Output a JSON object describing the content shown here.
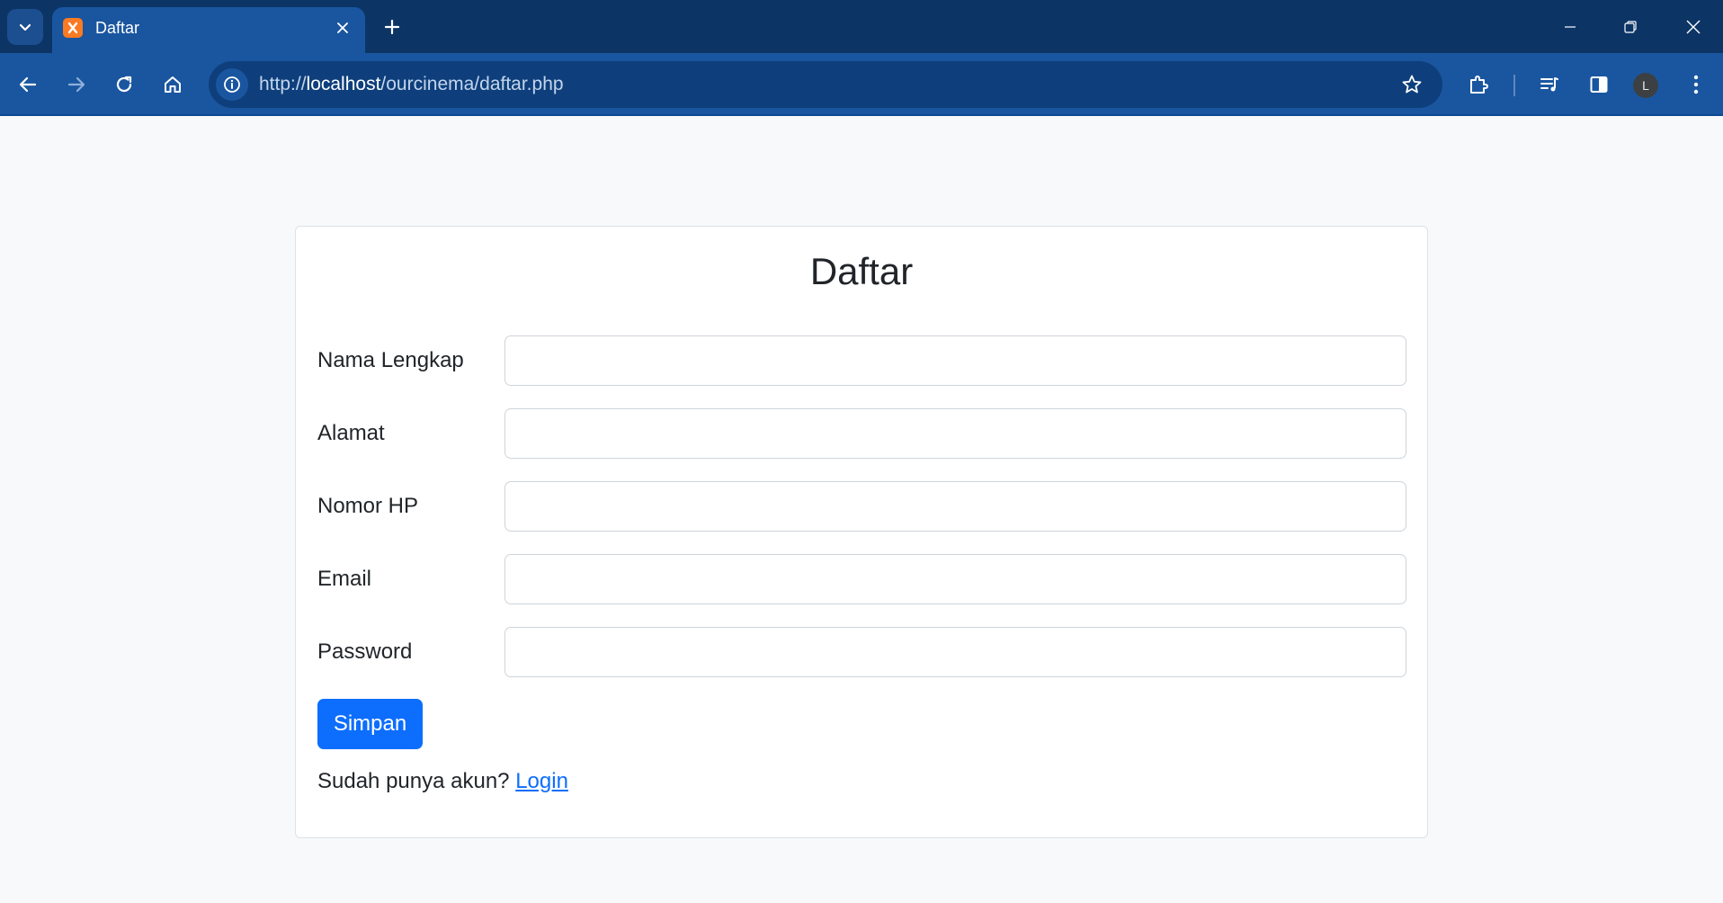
{
  "browser": {
    "tab_title": "Daftar",
    "url_scheme": "http://",
    "url_host": "localhost",
    "url_path": "/ourcinema/daftar.php",
    "profile_initial": "L",
    "colors": {
      "tabstrip": "#0c3566",
      "toolbar": "#1a56a0",
      "omnibox": "#0e3f7c",
      "favicon": "#fb7a24"
    },
    "icons": [
      "tab-search-icon",
      "xampp-favicon-icon",
      "close-icon",
      "plus-icon",
      "minimize-icon",
      "restore-icon",
      "window-close-icon",
      "back-arrow-icon",
      "forward-arrow-icon",
      "reload-icon",
      "home-icon",
      "site-info-icon",
      "star-icon",
      "extensions-icon",
      "media-control-icon",
      "side-panel-icon",
      "more-vert-icon"
    ]
  },
  "page": {
    "title": "Daftar",
    "fields": [
      {
        "label": "Nama Lengkap",
        "value": ""
      },
      {
        "label": "Alamat",
        "value": ""
      },
      {
        "label": "Nomor HP",
        "value": ""
      },
      {
        "label": "Email",
        "value": ""
      },
      {
        "label": "Password",
        "value": ""
      }
    ],
    "submit_label": "Simpan",
    "login_prompt": "Sudah punya akun?",
    "login_link": "Login",
    "colors": {
      "primary": "#0d6efd",
      "background": "#f8f9fa",
      "card_border": "#dee2e6"
    }
  }
}
